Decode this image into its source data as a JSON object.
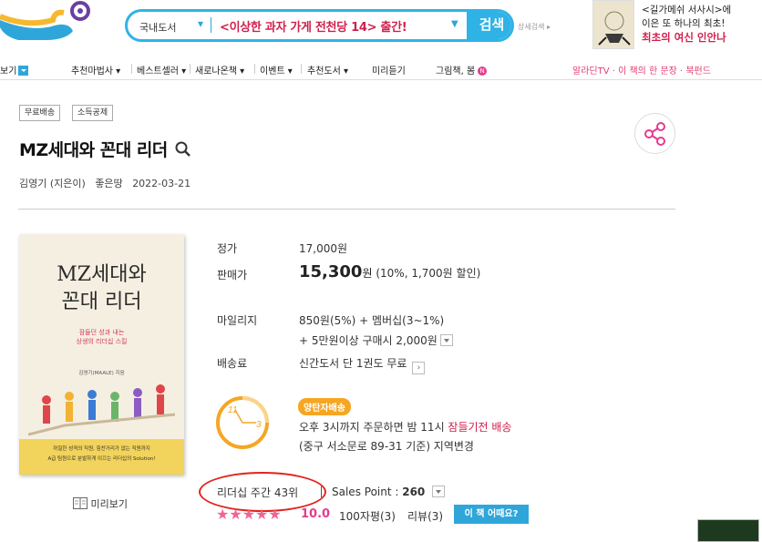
{
  "header": {
    "search_category": "국내도서",
    "search_text": "<이상한 과자 가게 전천당 14> 출간!",
    "search_button": "검색",
    "detail_search": "상세검색 ▸",
    "ad_line1": "<길가메쉬 서사시>에",
    "ad_line2": "이은 또 하나의 최초!",
    "ad_line3": "최초의 여신 인안나"
  },
  "nav": {
    "items": [
      {
        "label": "보기"
      },
      {
        "label": "추천마법사 ▾"
      },
      {
        "label": "베스트셀러 ▾"
      },
      {
        "label": "새로나온책 ▾"
      },
      {
        "label": "이벤트 ▾"
      },
      {
        "label": "추천도서 ▾"
      },
      {
        "label": "미리듣기"
      },
      {
        "label": "그림책, 봄"
      }
    ],
    "new_badge": "N",
    "right_links": "알라딘TV · 이 책의 한 문장 · 북펀드"
  },
  "book": {
    "tags": [
      "무료배송",
      "소득공제"
    ],
    "title": "MZ세대와 꼰대 리더",
    "author": "김영기 (지은이)",
    "publisher": "좋은땅",
    "date": "2022-03-21",
    "cover_title1": "MZ세대와",
    "cover_title2": "꼰대 리더",
    "cover_sub1": "잠들던 성과 내는",
    "cover_sub2": "상생의 리더십 스킬",
    "cover_author": "김영기(MAALE) 지음",
    "cover_band1": "까칠한 성격의 직원, 힘찬거리가 없는 직원까지",
    "cover_band2": "A급 팀원으로 분발하게 이끄는 리더십의 Solution!",
    "preview_label": "미리보기"
  },
  "pricing": {
    "list_price_label": "정가",
    "list_price": "17,000원",
    "sale_price_label": "판매가",
    "sale_price": "15,300",
    "sale_unit": "원",
    "discount": "(10%, 1,700원 할인)",
    "mileage_label": "마일리지",
    "mileage1": "850원(5%) + 멤버십(3~1%)",
    "mileage2": "+ 5만원이상 구매시 2,000원",
    "shipping_label": "배송료",
    "shipping": "신간도서 단 1권도 무료"
  },
  "delivery": {
    "badge": "양탄자배송",
    "line1_prefix": "오후 3시까지 주문하면 밤 11시 ",
    "line1_highlight": "잠들기전 배송",
    "line2": "(중구 서소문로 89-31 기준) 지역변경",
    "clock_11": "11",
    "clock_3": "3"
  },
  "rank": {
    "text": "리더십 주간 43위",
    "sales_point_label": "Sales Point : ",
    "sales_point": "260"
  },
  "rating": {
    "stars": 5,
    "score": "10.0",
    "review100": "100자평(3)",
    "review": "리뷰(3)",
    "how_button": "이 책 어때요?"
  },
  "colors": {
    "accent": "#2fb3e6",
    "pink": "#e63b8f",
    "highlight": "#d1204d"
  }
}
